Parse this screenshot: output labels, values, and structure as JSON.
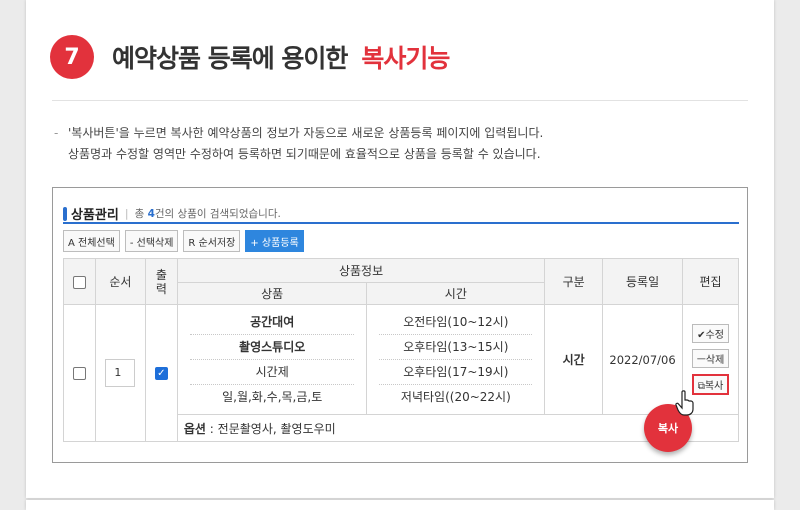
{
  "section": {
    "number": "7",
    "title": "예약상품 등록에 용이한",
    "highlight": "복사기능"
  },
  "description": {
    "line1": "'복사버튼'을 누르면 복사한 예약상품의 정보가 자동으로 새로운 상품등록 페이지에 입력됩니다.",
    "line2": "상품명과 수정할 영역만 수정하여 등록하면 되기때문에 효율적으로 상품을 등록할 수 있습니다."
  },
  "panel": {
    "title": "상품관리",
    "count_prefix": "총",
    "count": "4",
    "count_suffix": "건의 상품이 검색되었습니다.",
    "toolbar": {
      "select_all": "A 전체선택",
      "delete_selected": "- 선택삭제",
      "save_order": "R 순서저장",
      "add_product": "+ 상품등록"
    },
    "table": {
      "headers": {
        "order": "순서",
        "display": "출력",
        "product_info": "상품정보",
        "product": "상품",
        "time": "시간",
        "category": "구분",
        "reg_date": "등록일",
        "edit": "편집"
      },
      "row": {
        "order_value": "1",
        "products": [
          "공간대여",
          "촬영스튜디오",
          "시간제",
          "일,월,화,수,목,금,토"
        ],
        "times": [
          "오전타임(10~12시)",
          "오후타임(13~15시)",
          "오후타임(17~19시)",
          "저녁타임((20~22시)"
        ],
        "category": "시간",
        "reg_date": "2022/07/06",
        "edit_buttons": {
          "modify": "✔수정",
          "delete": "ㅡ삭제",
          "copy": "⧉복사"
        },
        "option_label": "옵션",
        "option_value": ": 전문촬영사, 촬영도우미"
      }
    }
  },
  "badge": {
    "label": "복사"
  },
  "colors": {
    "accent": "#e2323c",
    "blue": "#2a6fce"
  }
}
